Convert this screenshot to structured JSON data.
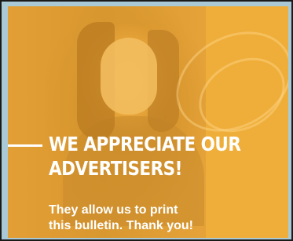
{
  "ad": {
    "headline_line1": "WE APPRECIATE OUR",
    "headline_line2": "ADVERTISERS!",
    "subtext_line1": "They allow us to print",
    "subtext_line2": "this bulletin. Thank you!"
  },
  "colors": {
    "overlay": "#e8a530",
    "text": "#ffffff",
    "frame": "#a9c9d6"
  }
}
